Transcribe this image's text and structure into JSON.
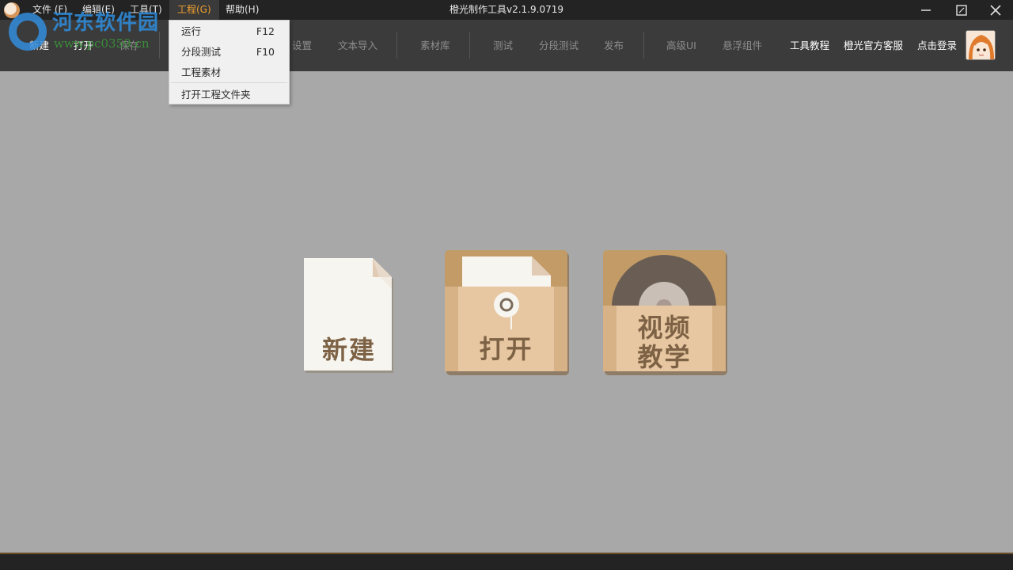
{
  "window": {
    "title": "橙光制作工具v2.1.9.0719"
  },
  "menubar": [
    {
      "label": "文件 (F)"
    },
    {
      "label": "编辑(E)"
    },
    {
      "label": "工具(T)"
    },
    {
      "label": "工程(G)"
    },
    {
      "label": "帮助(H)"
    }
  ],
  "toolbar": {
    "items": [
      "新建",
      "打开",
      "保存",
      "设置",
      "文本导入",
      "素材库",
      "测试",
      "分段测试",
      "发布",
      "高级UI",
      "悬浮组件"
    ],
    "right_links": [
      "工具教程",
      "橙光官方客服",
      "点击登录"
    ]
  },
  "dropdown": {
    "items": [
      {
        "label": "运行",
        "shortcut": "F12"
      },
      {
        "label": "分段测试",
        "shortcut": "F10"
      },
      {
        "label": "工程素材",
        "shortcut": ""
      },
      {
        "label": "打开工程文件夹",
        "shortcut": ""
      }
    ]
  },
  "cards": {
    "new": "新建",
    "open": "打开",
    "video_line1": "视频",
    "video_line2": "教学"
  },
  "watermark": {
    "main": "河东软件园",
    "sub": "www.pc0359.cn"
  },
  "icons": [
    "app-logo-icon",
    "minimize-icon",
    "maximize-icon",
    "close-icon",
    "document-icon",
    "folder-icon",
    "disc-icon",
    "avatar-icon"
  ],
  "colors": {
    "titlebar": "#232323",
    "toolbar": "#3b3b3b",
    "workspace": "#a8a8a8",
    "menu_active_text": "#f0a030",
    "card_brown": "#c49a66",
    "card_label": "#7d6245"
  }
}
